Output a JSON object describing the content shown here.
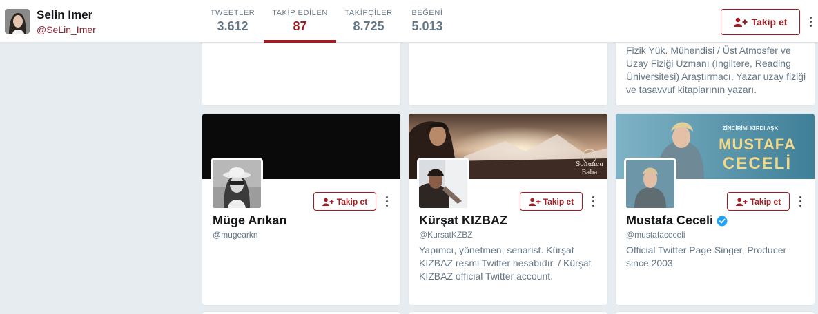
{
  "profile": {
    "name": "Selin Imer",
    "handle": "@SeLin_Imer",
    "follow_label": "Takip et"
  },
  "stats": [
    {
      "label": "TWEETLER",
      "value": "3.612",
      "active": false
    },
    {
      "label": "TAKİP EDİLEN",
      "value": "87",
      "active": true
    },
    {
      "label": "TAKİPÇİLER",
      "value": "8.725",
      "active": false
    },
    {
      "label": "BEĞENİ",
      "value": "5.013",
      "active": false
    }
  ],
  "top_cards": [
    {
      "bio": ""
    },
    {
      "bio": ""
    },
    {
      "bio": "Fizik Yük. Mühendisi / Üst Atmosfer ve Uzay Fiziği Uzmanı (İngiltere, Reading Üniversitesi) Araştırmacı, Yazar uzay fiziği ve tasavvuf kitaplarının yazarı."
    }
  ],
  "cards": [
    {
      "name": "Müge Arıkan",
      "handle": "@mugearkn",
      "bio": "",
      "follow_label": "Takip et",
      "verified": false
    },
    {
      "name": "Kürşat KIZBAZ",
      "handle": "@KursatKZBZ",
      "bio": "Yapımcı, yönetmen, senarist. Kürşat KIZBAZ resmi Twitter hesabıdır. / Kürşat KIZBAZ official Twitter account.",
      "follow_label": "Takip et",
      "verified": false,
      "banner_text": [
        "Sonuncu",
        "Baba"
      ]
    },
    {
      "name": "Mustafa Ceceli",
      "handle": "@mustafaceceli",
      "bio": "Official Twitter Page Singer, Producer since 2003",
      "follow_label": "Takip et",
      "verified": true,
      "banner_text": [
        "ZİNCİRİMİ KIRDI AŞK",
        "MUSTAFA",
        "CECELİ"
      ]
    }
  ],
  "colors": {
    "accent": "#a01b22",
    "muted": "#657786",
    "page_bg": "#e6ecf0",
    "verified": "#1da1f2"
  }
}
